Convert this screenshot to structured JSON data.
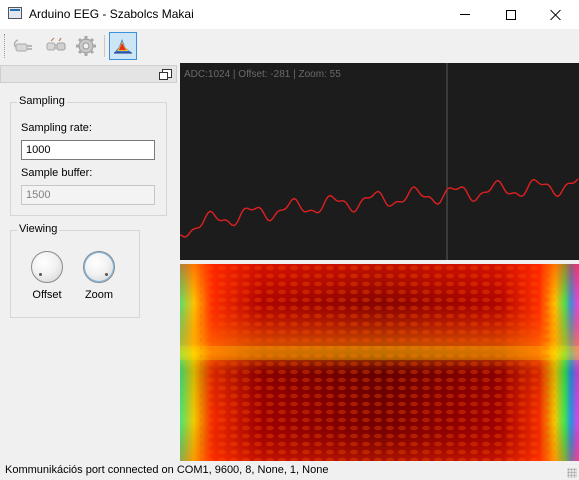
{
  "window": {
    "title": "Arduino EEG - Szabolcs Makai"
  },
  "toolbar": {
    "items": [
      {
        "icon": "plug-connect-icon"
      },
      {
        "icon": "plug-disconnect-icon"
      },
      {
        "icon": "gear-icon"
      },
      {
        "icon": "spectrum-icon",
        "active": true
      }
    ]
  },
  "dock": {
    "sampling": {
      "title": "Sampling",
      "rate_label": "Sampling rate:",
      "rate_value": "1000",
      "buffer_label": "Sample buffer:",
      "buffer_value": "1500"
    },
    "viewing": {
      "title": "Viewing",
      "offset_label": "Offset",
      "zoom_label": "Zoom"
    }
  },
  "plot": {
    "info": "ADC:1024 | Offset: -281 | Zoom: 55",
    "colors": {
      "background": "#1c1c1c",
      "signal": "#e02020",
      "cursor": "#5a5a5a"
    }
  },
  "statusbar": {
    "text": "Kommunikációs port connected on COM1, 9600, 8, None, 1, None"
  }
}
